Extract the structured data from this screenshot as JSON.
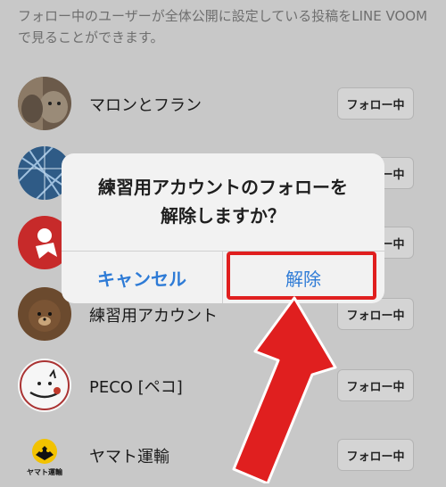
{
  "description": "フォロー中のユーザーが全体公開に設定している投稿をLINE VOOMで見ることができます。",
  "accounts": [
    {
      "name": "マロンとフラン",
      "button": "フォロー中"
    },
    {
      "name": "",
      "button": "フォロー中"
    },
    {
      "name": "",
      "button": "フォロー中"
    },
    {
      "name": "練習用アカウント",
      "button": "フォロー中"
    },
    {
      "name": "PECO [ペコ]",
      "button": "フォロー中"
    },
    {
      "name": "ヤマト運輸",
      "button": "フォロー中"
    }
  ],
  "yamato_logo_text": "ヤマト運輸",
  "dialog": {
    "title_line1": "練習用アカウントのフォローを",
    "title_line2": "解除しますか？",
    "cancel_label": "キャンセル",
    "confirm_label": "解除"
  },
  "colors": {
    "annotation": "#e01f1f",
    "dialog_button": "#2e7bd6"
  }
}
